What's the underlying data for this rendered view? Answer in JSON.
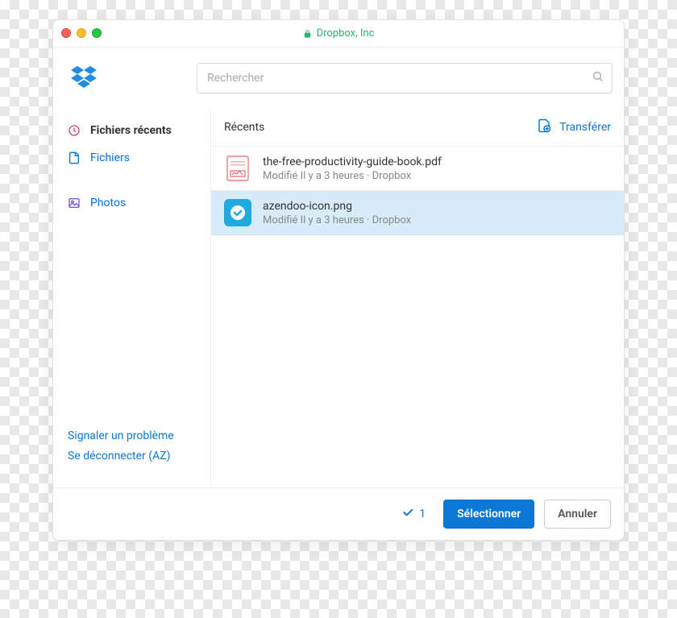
{
  "window": {
    "title": "Dropbox, Inc"
  },
  "search": {
    "placeholder": "Rechercher"
  },
  "sidebar": {
    "items": [
      {
        "id": "recent",
        "label": "Fichiers récents",
        "icon": "clock",
        "active": true
      },
      {
        "id": "files",
        "label": "Fichiers",
        "icon": "document",
        "active": false
      },
      {
        "id": "photos",
        "label": "Photos",
        "icon": "image",
        "active": false
      }
    ],
    "links": {
      "report_problem": "Signaler un problème",
      "logout": "Se déconnecter (AZ)"
    }
  },
  "main": {
    "section_title": "Récents",
    "transfer_label": "Transférer",
    "files": [
      {
        "name": "the-free-productivity-guide-book.pdf",
        "subtitle": "Modifié Il y a 3 heures · Dropbox",
        "icon": "pdf",
        "selected": false
      },
      {
        "name": "azendoo-icon.png",
        "subtitle": "Modifié Il y a 3 heures · Dropbox",
        "icon": "png-azendoo",
        "selected": true
      }
    ]
  },
  "footer": {
    "selected_count": "1",
    "select_label": "Sélectionner",
    "cancel_label": "Annuler"
  }
}
